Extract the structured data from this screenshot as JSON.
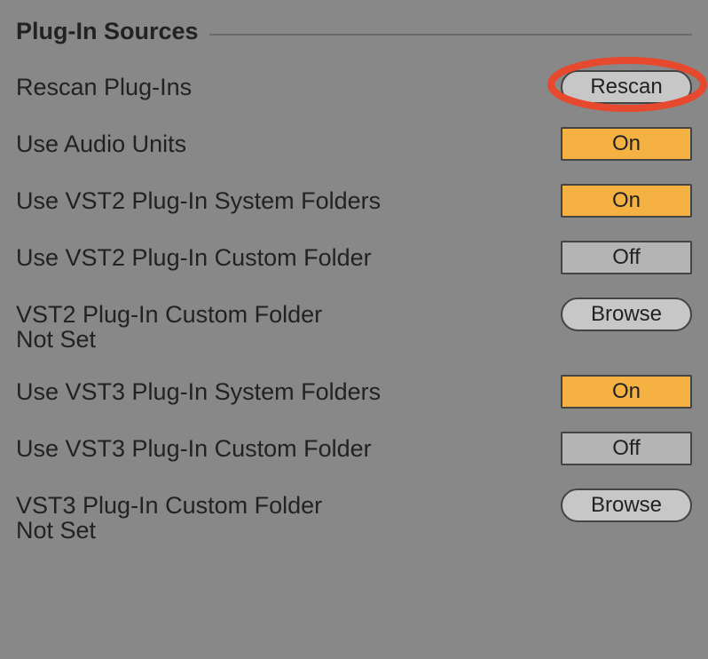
{
  "section_title": "Plug-In Sources",
  "rescan": {
    "label": "Rescan Plug-Ins",
    "button": "Rescan"
  },
  "audio_units": {
    "label": "Use Audio Units",
    "state": "On"
  },
  "vst2_system": {
    "label": "Use VST2 Plug-In System Folders",
    "state": "On"
  },
  "vst2_custom_toggle": {
    "label": "Use VST2 Plug-In Custom Folder",
    "state": "Off"
  },
  "vst2_custom_path": {
    "label": "VST2 Plug-In Custom Folder",
    "button": "Browse",
    "value": "Not Set"
  },
  "vst3_system": {
    "label": "Use VST3 Plug-In System Folders",
    "state": "On"
  },
  "vst3_custom_toggle": {
    "label": "Use VST3 Plug-In Custom Folder",
    "state": "Off"
  },
  "vst3_custom_path": {
    "label": "VST3 Plug-In Custom Folder",
    "button": "Browse",
    "value": "Not Set"
  }
}
